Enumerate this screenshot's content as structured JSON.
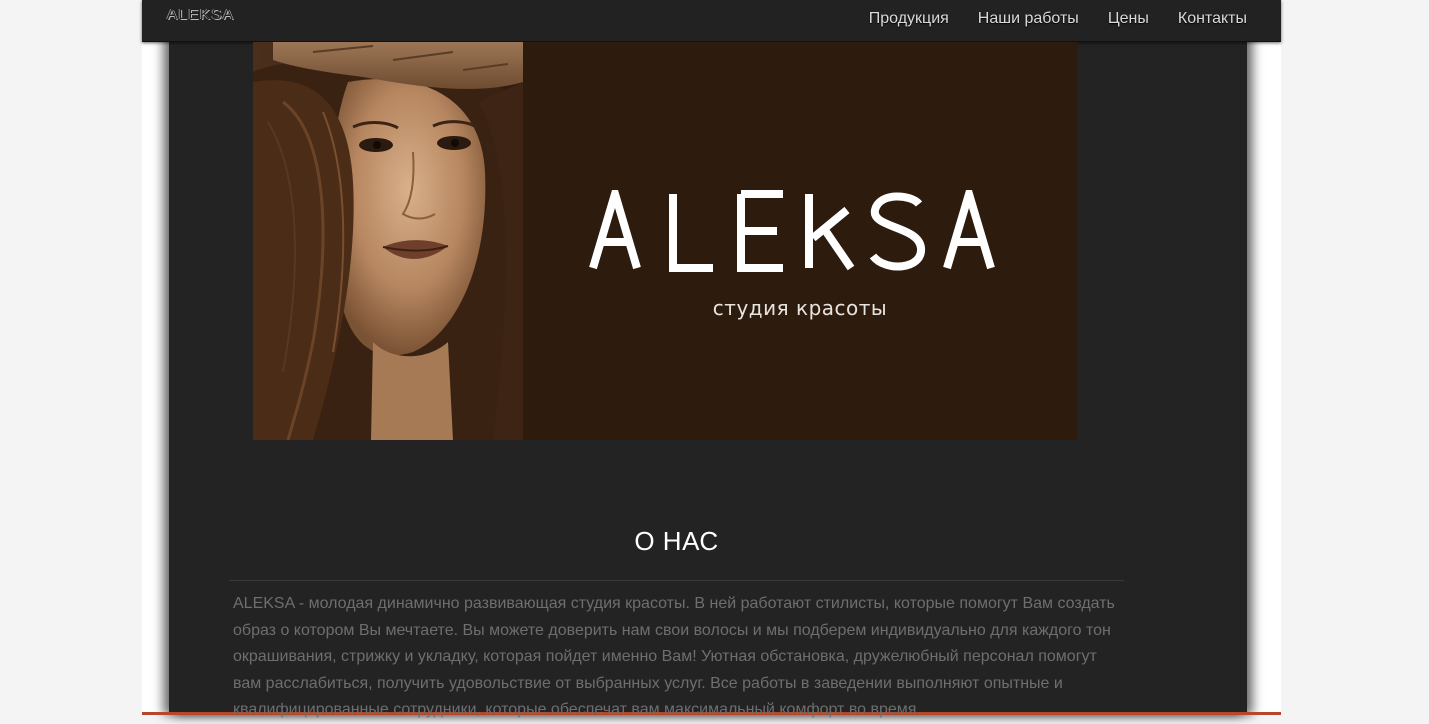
{
  "navbar": {
    "brand": "ALEKSA",
    "links": [
      "Продукция",
      "Наши работы",
      "Цены",
      "Контакты"
    ]
  },
  "hero": {
    "logo_text": "ALEKSA",
    "subtitle": "студия красоты"
  },
  "about": {
    "heading": "О НАС",
    "text": "ALEKSA - молодая динамично развивающая студия красоты. В ней работают стилисты, которые помогут Вам создать образ о котором Вы мечтаете. Вы можете доверить нам свои волосы и мы подберем индивидуально для каждого тон окрашивания, стрижку и укладку, которая пойдет именно Вам! Уютная обстановка, дружелюбный персонал помогут вам расслабиться, получить удовольствие от выбранных услуг. Все работы в заведении выполняют опытные и квалифицированные сотрудники, которые обеспечат вам максимальный комфорт во время"
  },
  "colors": {
    "panel": "#232323",
    "navbar": "#222222",
    "hero_bg": "#2d1b0e",
    "accent_strip": "#b5472a"
  }
}
